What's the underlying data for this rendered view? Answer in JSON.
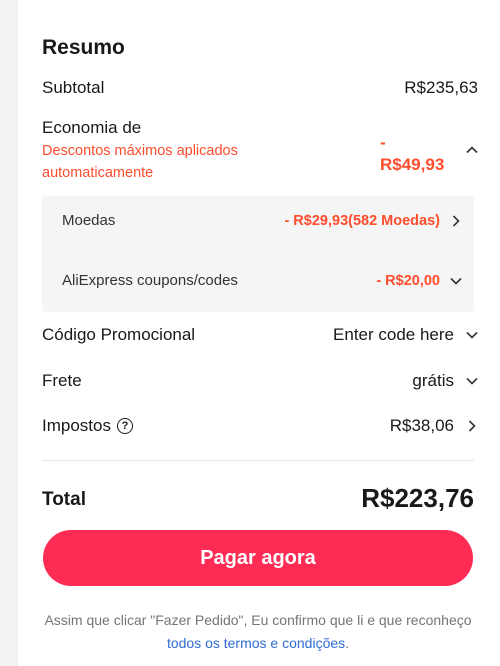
{
  "summary": {
    "title": "Resumo",
    "subtotal_label": "Subtotal",
    "subtotal_value": "R$235,63",
    "savings_label": "Economia de",
    "savings_sub": "Descontos máximos aplicados automaticamente",
    "savings_value_sign": "-",
    "savings_value": "R$49,93",
    "coins_label": "Moedas",
    "coins_value": "- R$29,93(582 Moedas)",
    "coupons_label": "AliExpress coupons/codes",
    "coupons_value": "- R$20,00",
    "promo_label": "Código Promocional",
    "promo_value": "Enter code here",
    "shipping_label": "Frete",
    "shipping_value": "grátis",
    "taxes_label": "Impostos",
    "taxes_help": "?",
    "taxes_value": "R$38,06",
    "total_label": "Total",
    "total_value": "R$223,76"
  },
  "actions": {
    "pay_label": "Pagar agora"
  },
  "legal": {
    "text": "Assim que clicar \"Fazer Pedido\", Eu confirmo que li e que reconheço ",
    "link": "todos os termos e condições",
    "end": "."
  },
  "colors": {
    "accent": "#fe2c55",
    "discount": "#ff4d2d",
    "link": "#2e6cd6"
  },
  "icons": [
    "chevron-up-icon",
    "chevron-right-icon",
    "chevron-down-icon",
    "help-circle-icon"
  ]
}
